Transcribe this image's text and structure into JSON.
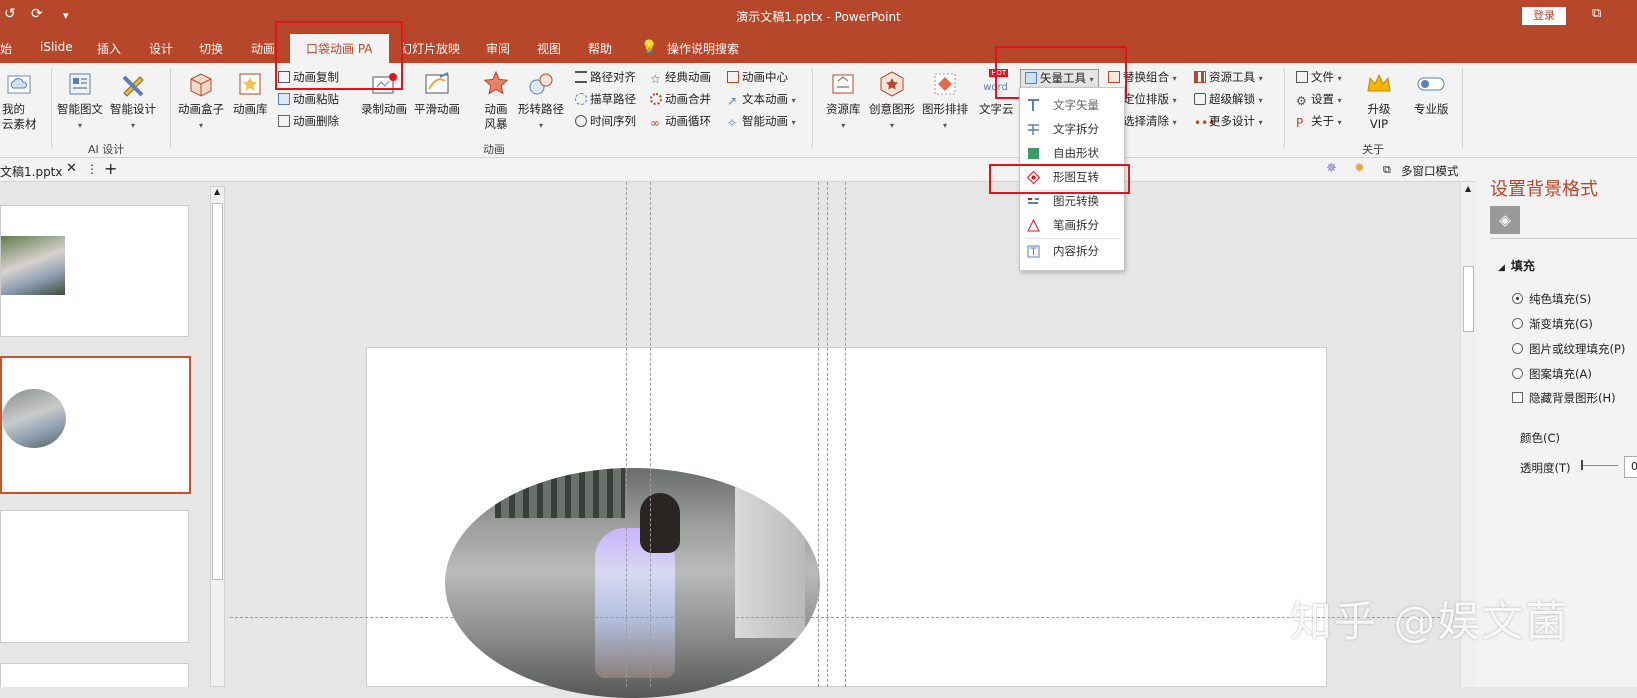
{
  "window": {
    "title": "演示文稿1.pptx - PowerPoint",
    "login": "登录"
  },
  "tabs": [
    "始",
    "iSlide",
    "插入",
    "设计",
    "切换",
    "动画",
    "口袋动画 PA",
    "幻灯片放映",
    "审阅",
    "视图",
    "帮助",
    "操作说明搜索"
  ],
  "ribbon": {
    "cloud_btn": [
      "我的",
      "云素材"
    ],
    "ai_group": {
      "smart_text": "智能图文",
      "smart_design": "智能设计",
      "label": "AI 设计"
    },
    "anim_group": {
      "box": "动画盒子",
      "lib": "动画库",
      "copy": "动画复制",
      "paste": "动画粘贴",
      "delete": "动画删除",
      "record": "录制动画",
      "smooth": "平滑动画",
      "storm": [
        "动画",
        "风暴"
      ],
      "morph_path": "形转路径",
      "path_align": "路径对齐",
      "sketch_path": "描草路径",
      "time_seq": "时间序列",
      "classic": "经典动画",
      "merge": "动画合并",
      "loop": "动画循环",
      "center": "动画中心",
      "text_anim": "文本动画",
      "smart_anim": "智能动画",
      "label": "动画"
    },
    "design_group": {
      "res_lib": "资源库",
      "creative": "创意图形",
      "layout": "图形排排",
      "text_cloud": "文字云",
      "vector": "矢量工具",
      "replace": "替换组合",
      "position": "定位排版",
      "select_clear": "选择清除",
      "res_tool": "资源工具",
      "super": "超级解锁",
      "more": "更多设计",
      "hot": "HOT",
      "word": "word"
    },
    "about_group": {
      "file": "文件",
      "settings": "设置",
      "about": "关于",
      "vip": [
        "升级",
        "VIP"
      ],
      "pro": "专业版",
      "label": "关于"
    }
  },
  "vector_menu": [
    "文字矢量",
    "文字拆分",
    "自由形状",
    "形图互转",
    "图元转换",
    "笔画拆分",
    "内容拆分"
  ],
  "docbar": {
    "doc_tab": "文稿1.pptx",
    "multi_window": "多窗口模式"
  },
  "format_panel": {
    "title": "设置背景格式",
    "section": "填充",
    "options": [
      "纯色填充(S)",
      "渐变填充(G)",
      "图片或纹理填充(P)",
      "图案填充(A)"
    ],
    "selected": 0,
    "hide_bg": "隐藏背景图形(H)",
    "color": "颜色(C)",
    "transparency": "透明度(T)",
    "trans_value": "0"
  },
  "watermark": "知乎 @娱文菌",
  "colors": {
    "accent": "#b7472a",
    "highlight": "#e0141e"
  }
}
